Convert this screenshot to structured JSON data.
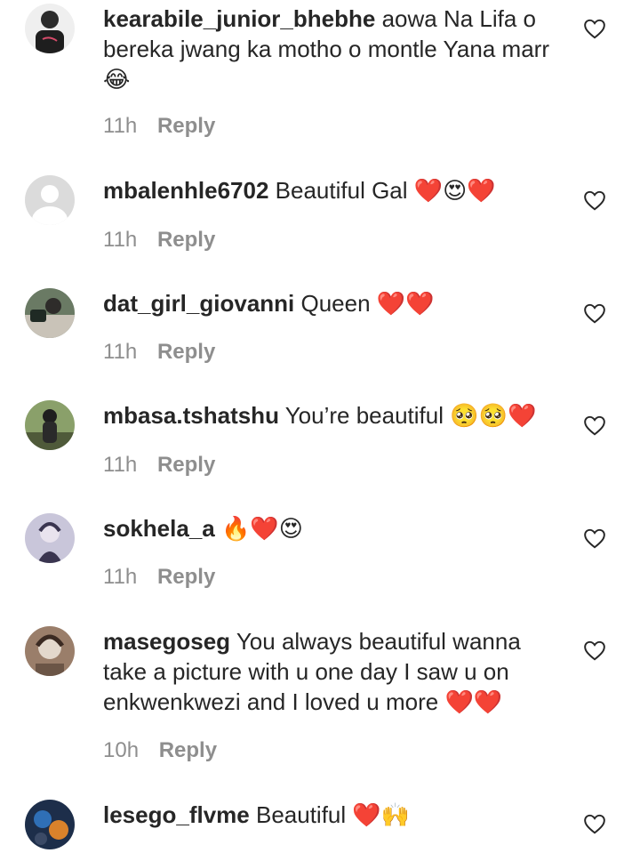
{
  "comments": [
    {
      "username": "kearabile_junior_bhebhe",
      "text": "aowa Na Lifa o bereka jwang ka motho o montle Yana marr",
      "emoji": "😂",
      "time": "11h",
      "reply": "Reply",
      "avatar": {
        "type": "photo",
        "colors": [
          "#f2f2f2",
          "#2b2b2b",
          "#d64b6a"
        ]
      }
    },
    {
      "username": "mbalenhle6702",
      "text": "Beautiful Gal",
      "emoji": "❤️😍❤️",
      "time": "11h",
      "reply": "Reply",
      "avatar": {
        "type": "default"
      }
    },
    {
      "username": "dat_girl_giovanni",
      "text": "Queen",
      "emoji": "❤️❤️",
      "time": "11h",
      "reply": "Reply",
      "avatar": {
        "type": "photo",
        "colors": [
          "#5a6a55",
          "#c9c3b8",
          "#2e2c2a"
        ]
      }
    },
    {
      "username": "mbasa.tshatshu",
      "text": "You’re beautiful",
      "emoji": "🥺🥺❤️",
      "time": "11h",
      "reply": "Reply",
      "avatar": {
        "type": "photo",
        "colors": [
          "#8aa06a",
          "#4f5a3a",
          "#1f1f1f"
        ]
      }
    },
    {
      "username": "sokhela_a",
      "text": "",
      "emoji": "🔥❤️😍",
      "time": "11h",
      "reply": "Reply",
      "avatar": {
        "type": "photo",
        "colors": [
          "#b9b7cf",
          "#e9e3ee",
          "#3a3550"
        ]
      }
    },
    {
      "username": "masegoseg",
      "text": "You always beautiful wanna take a picture with u one day I saw u on enkwenkwezi and I loved u more",
      "emoji": "❤️❤️",
      "time": "10h",
      "reply": "Reply",
      "avatar": {
        "type": "photo",
        "colors": [
          "#9a7e6a",
          "#e3d8cc",
          "#3b2a22"
        ]
      }
    },
    {
      "username": "lesego_flvme",
      "text": "Beautiful",
      "emoji": "❤️🙌",
      "time": "",
      "reply": "",
      "avatar": {
        "type": "photo",
        "colors": [
          "#1d2e4a",
          "#2f6fb6",
          "#d9822b"
        ]
      }
    }
  ],
  "icons": {
    "like": "heart-outline-icon"
  },
  "colors": {
    "text": "#262626",
    "meta": "#8e8e8e",
    "background": "#ffffff"
  }
}
